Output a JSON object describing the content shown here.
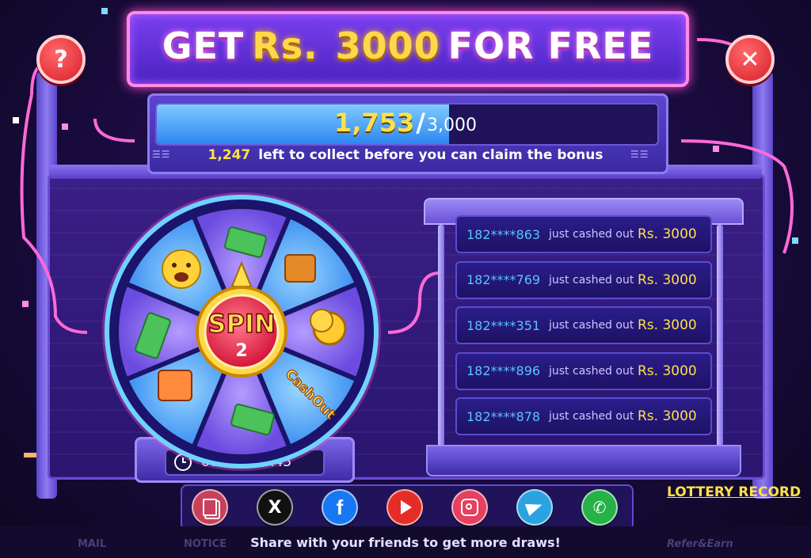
{
  "title": {
    "part1": "GET",
    "currency": "Rs.",
    "amount": "3000",
    "part2": "FOR FREE"
  },
  "buttons": {
    "help": "?",
    "close": "✕"
  },
  "progress": {
    "current": "1,753",
    "separator": "/",
    "total": "3,000",
    "current_value": 1753,
    "total_value": 3000,
    "left_count": "1,247",
    "left_text": "left to collect before you can claim the bonus"
  },
  "wheel": {
    "spin_label": "SPIN",
    "spin_count": "2",
    "cashout_label": "CashOut",
    "segments": [
      "cash-icon",
      "treasure-chest-icon",
      "gold-coins-icon",
      "cashout",
      "cash-icon",
      "gift-box-icon",
      "cash-icon",
      "crying-emoji-icon"
    ],
    "timer": "06d 23:04:45"
  },
  "records": [
    {
      "id": "182****863",
      "text": "just cashed out",
      "amount": "Rs. 3000"
    },
    {
      "id": "182****769",
      "text": "just cashed out",
      "amount": "Rs. 3000"
    },
    {
      "id": "182****351",
      "text": "just cashed out",
      "amount": "Rs. 3000"
    },
    {
      "id": "182****896",
      "text": "just cashed out",
      "amount": "Rs. 3000"
    },
    {
      "id": "182****878",
      "text": "just cashed out",
      "amount": "Rs. 3000"
    }
  ],
  "share": {
    "caption": "Share with your friends to get more draws!",
    "lottery_record": "LOTTERY RECORD",
    "x_glyph": "X",
    "facebook_glyph": "f",
    "buttons": [
      {
        "name": "copy-link",
        "color": "#c8415a"
      },
      {
        "name": "x",
        "color": "#111111"
      },
      {
        "name": "facebook",
        "color": "#1877f2"
      },
      {
        "name": "youtube",
        "color": "#e52d27"
      },
      {
        "name": "instagram",
        "color": "#e4405f"
      },
      {
        "name": "telegram",
        "color": "#2aa3e0"
      },
      {
        "name": "whatsapp",
        "color": "#25b246"
      }
    ]
  },
  "bottom_nav": {
    "mail": "MAIL",
    "notice": "NOTICE",
    "refer": "Refer&Earn"
  },
  "colors": {
    "neon": "#ff69d8",
    "gold": "#ffd84a",
    "progress_blue": "#2e86f0"
  }
}
